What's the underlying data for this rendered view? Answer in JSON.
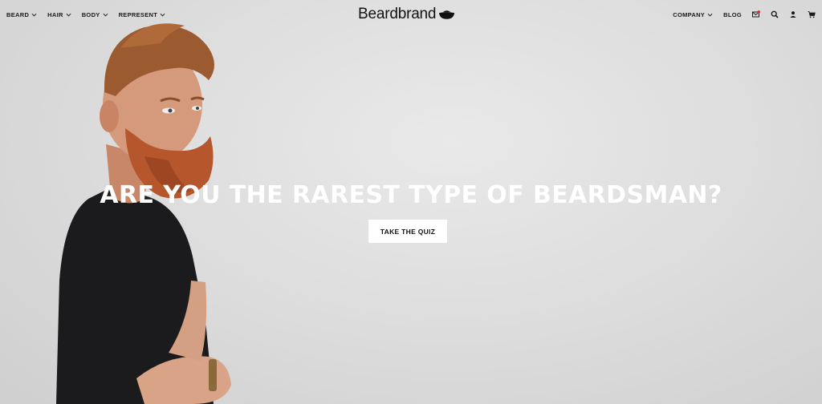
{
  "nav": {
    "left_items": [
      {
        "label": "BEARD"
      },
      {
        "label": "HAIR"
      },
      {
        "label": "BODY"
      },
      {
        "label": "REPRESENT"
      }
    ],
    "logo_text": "Beardbrand",
    "right_items": [
      {
        "label": "COMPANY"
      },
      {
        "label": "BLOG"
      }
    ],
    "icons": [
      "mail-icon",
      "search-icon",
      "account-icon",
      "cart-icon"
    ],
    "notification_color": "#e0262a"
  },
  "hero": {
    "headline": "ARE YOU THE RAREST TYPE OF BEARDSMAN?",
    "cta_label": "TAKE THE QUIZ",
    "background_color": "#dcdcdc",
    "beard_color": "#b5562c",
    "shirt_color": "#1b1b1d"
  }
}
